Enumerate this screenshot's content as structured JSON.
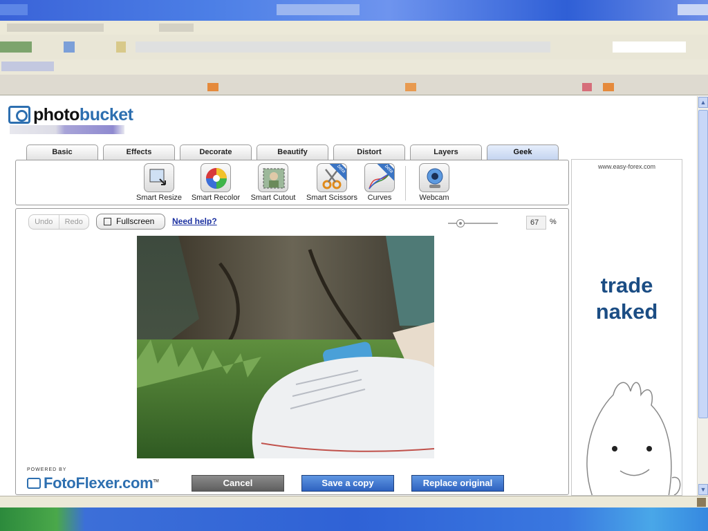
{
  "app": {
    "name": "photobucket"
  },
  "tabs": [
    {
      "label": "Basic"
    },
    {
      "label": "Effects"
    },
    {
      "label": "Decorate"
    },
    {
      "label": "Beautify"
    },
    {
      "label": "Distort"
    },
    {
      "label": "Layers"
    },
    {
      "label": "Geek",
      "active": true
    }
  ],
  "tools": [
    {
      "label": "Smart Resize",
      "icon": "smart-resize-icon"
    },
    {
      "label": "Smart Recolor",
      "icon": "color-wheel-icon"
    },
    {
      "label": "Smart Cutout",
      "icon": "smart-cutout-icon"
    },
    {
      "label": "Smart Scissors",
      "icon": "scissors-icon",
      "badge": "beta"
    },
    {
      "label": "Curves",
      "icon": "curves-icon",
      "badge": "beta"
    },
    {
      "label": "Webcam",
      "icon": "webcam-icon"
    }
  ],
  "editor": {
    "undo": "Undo",
    "redo": "Redo",
    "fullscreen": "Fullscreen",
    "help": "Need help?",
    "zoom": "67",
    "zoom_unit": "%"
  },
  "footer": {
    "powered_by": "POWERED BY",
    "brand": "FotoFlexer.com",
    "tm": "TM",
    "cancel": "Cancel",
    "save_copy": "Save a copy",
    "replace": "Replace original"
  },
  "ad": {
    "url": "www.easy-forex.com",
    "line1": "trade",
    "line2": "naked"
  },
  "colors": {
    "accent": "#2d6fb0",
    "button": "#3b6fc8",
    "tab_active": "#c3d3ef"
  }
}
